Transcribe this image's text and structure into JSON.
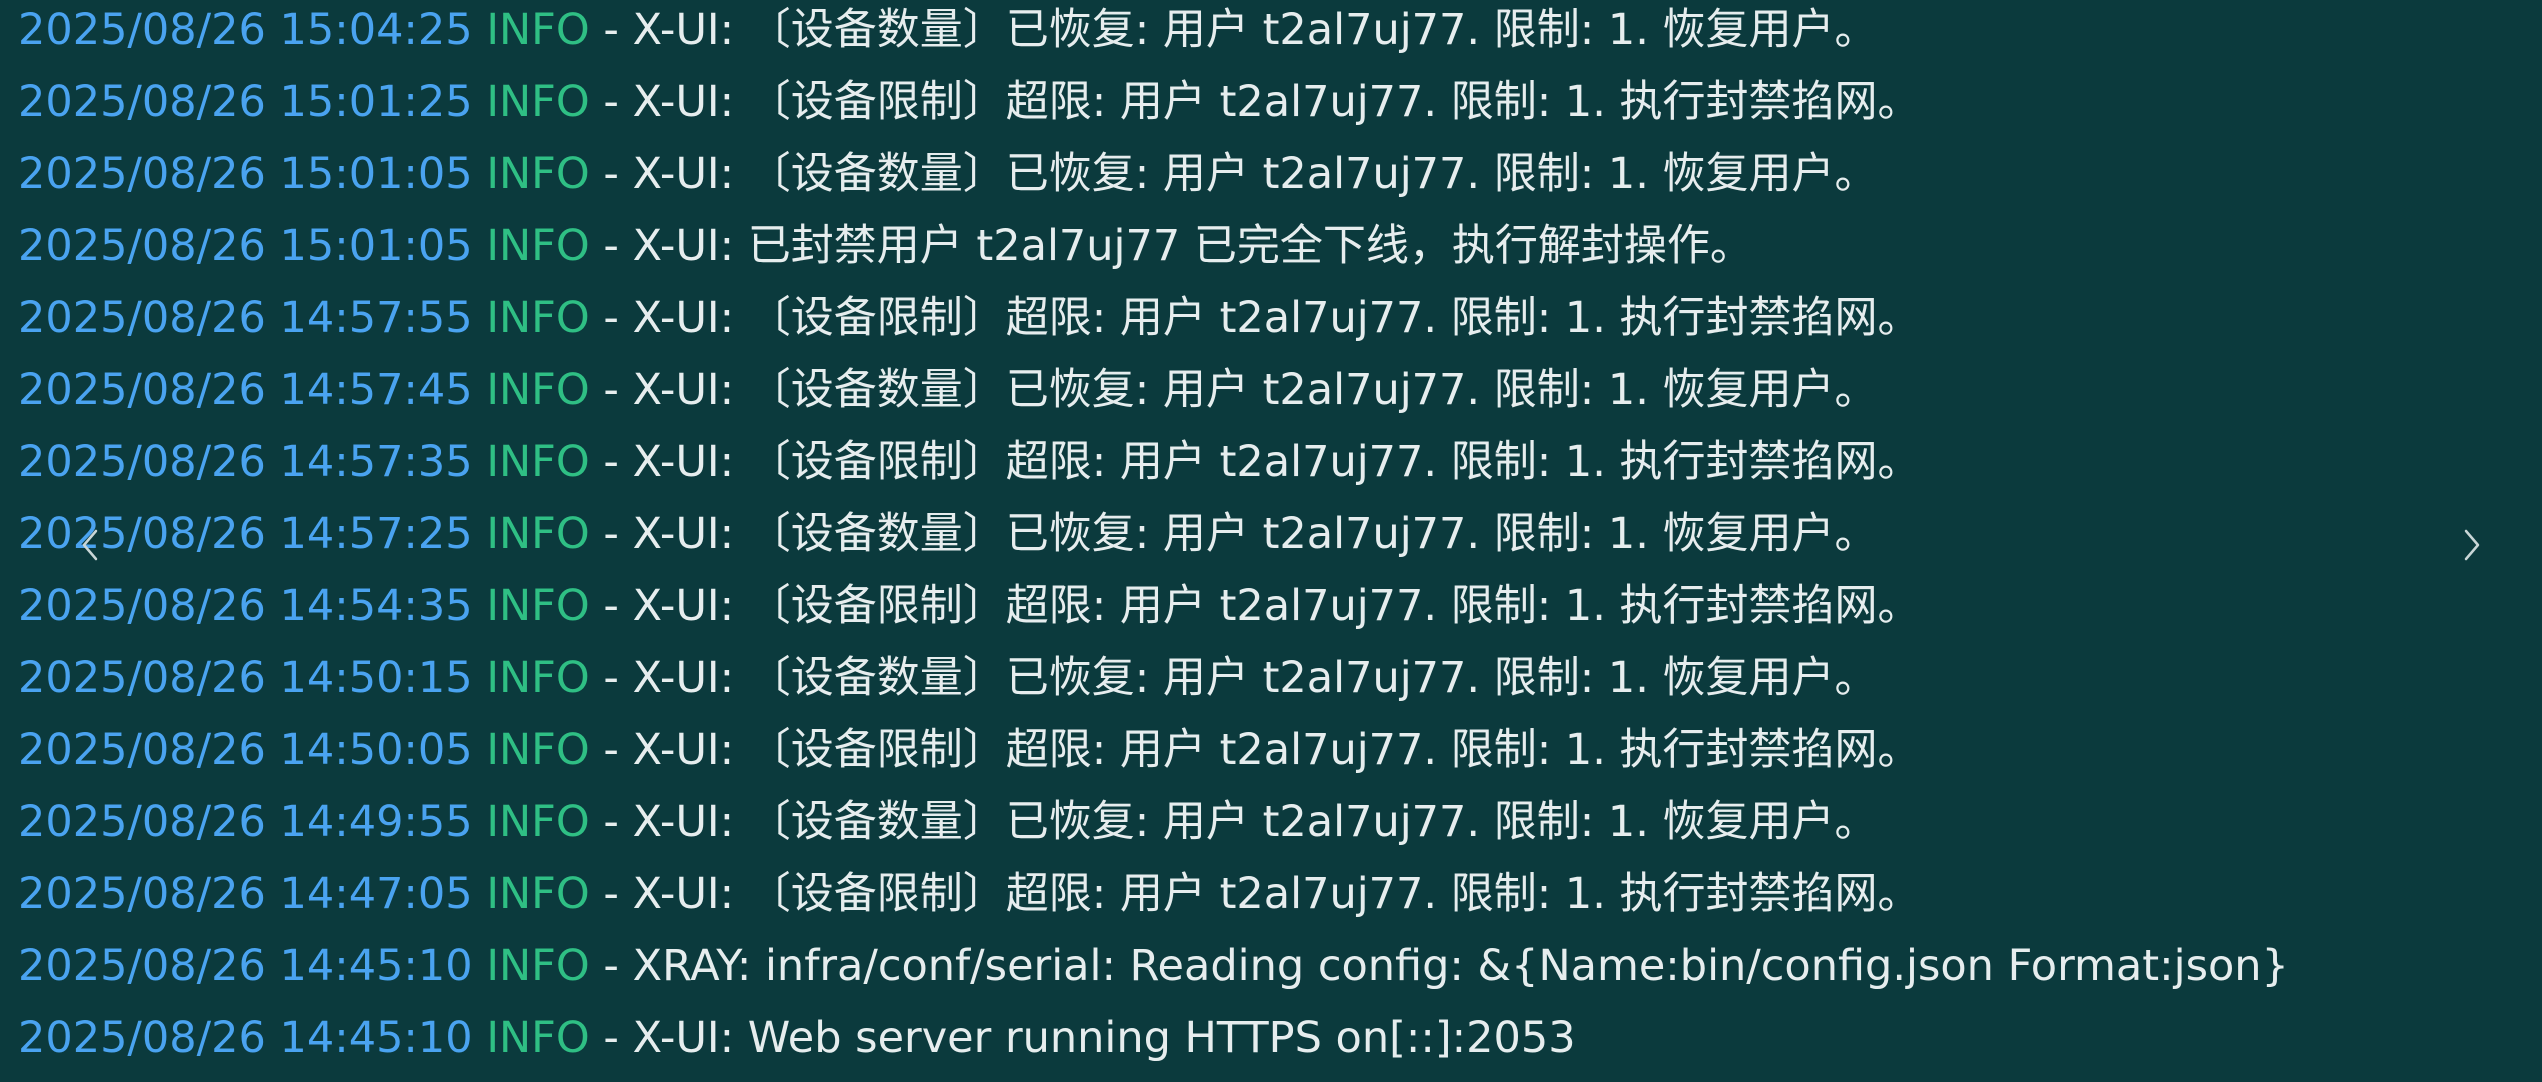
{
  "colors": {
    "background": "#0b3a3d",
    "timestamp": "#4aa3f0",
    "level": "#2fbf84",
    "text": "#e6edee",
    "nav": "#c9d6d7"
  },
  "navigation": {
    "prev_icon": "chevron-left-icon",
    "next_icon": "chevron-right-icon"
  },
  "log": {
    "separator": " - ",
    "lines": [
      {
        "timestamp": "2025/08/26 15:04:25",
        "level": "INFO",
        "message": "X-UI: 〔设备数量〕已恢复: 用户 t2al7uj77. 限制: 1. 恢复用户。"
      },
      {
        "timestamp": "2025/08/26 15:01:25",
        "level": "INFO",
        "message": "X-UI: 〔设备限制〕超限: 用户 t2al7uj77. 限制: 1. 执行封禁掐网。"
      },
      {
        "timestamp": "2025/08/26 15:01:05",
        "level": "INFO",
        "message": "X-UI: 〔设备数量〕已恢复: 用户 t2al7uj77. 限制: 1. 恢复用户。"
      },
      {
        "timestamp": "2025/08/26 15:01:05",
        "level": "INFO",
        "message": "X-UI: 已封禁用户 t2al7uj77 已完全下线，执行解封操作。"
      },
      {
        "timestamp": "2025/08/26 14:57:55",
        "level": "INFO",
        "message": "X-UI: 〔设备限制〕超限: 用户 t2al7uj77. 限制: 1. 执行封禁掐网。"
      },
      {
        "timestamp": "2025/08/26 14:57:45",
        "level": "INFO",
        "message": "X-UI: 〔设备数量〕已恢复: 用户 t2al7uj77. 限制: 1. 恢复用户。"
      },
      {
        "timestamp": "2025/08/26 14:57:35",
        "level": "INFO",
        "message": "X-UI: 〔设备限制〕超限: 用户 t2al7uj77. 限制: 1. 执行封禁掐网。"
      },
      {
        "timestamp": "2025/08/26 14:57:25",
        "level": "INFO",
        "message": "X-UI: 〔设备数量〕已恢复: 用户 t2al7uj77. 限制: 1. 恢复用户。"
      },
      {
        "timestamp": "2025/08/26 14:54:35",
        "level": "INFO",
        "message": "X-UI: 〔设备限制〕超限: 用户 t2al7uj77. 限制: 1. 执行封禁掐网。"
      },
      {
        "timestamp": "2025/08/26 14:50:15",
        "level": "INFO",
        "message": "X-UI: 〔设备数量〕已恢复: 用户 t2al7uj77. 限制: 1. 恢复用户。"
      },
      {
        "timestamp": "2025/08/26 14:50:05",
        "level": "INFO",
        "message": "X-UI: 〔设备限制〕超限: 用户 t2al7uj77. 限制: 1. 执行封禁掐网。"
      },
      {
        "timestamp": "2025/08/26 14:49:55",
        "level": "INFO",
        "message": "X-UI: 〔设备数量〕已恢复: 用户 t2al7uj77. 限制: 1. 恢复用户。"
      },
      {
        "timestamp": "2025/08/26 14:47:05",
        "level": "INFO",
        "message": "X-UI: 〔设备限制〕超限: 用户 t2al7uj77. 限制: 1. 执行封禁掐网。"
      },
      {
        "timestamp": "2025/08/26 14:45:10",
        "level": "INFO",
        "message": "XRAY: infra/conf/serial: Reading config: &{Name:bin/config.json Format:json}"
      },
      {
        "timestamp": "2025/08/26 14:45:10",
        "level": "INFO",
        "message": "X-UI: Web server running HTTPS on[::]:2053"
      }
    ]
  }
}
